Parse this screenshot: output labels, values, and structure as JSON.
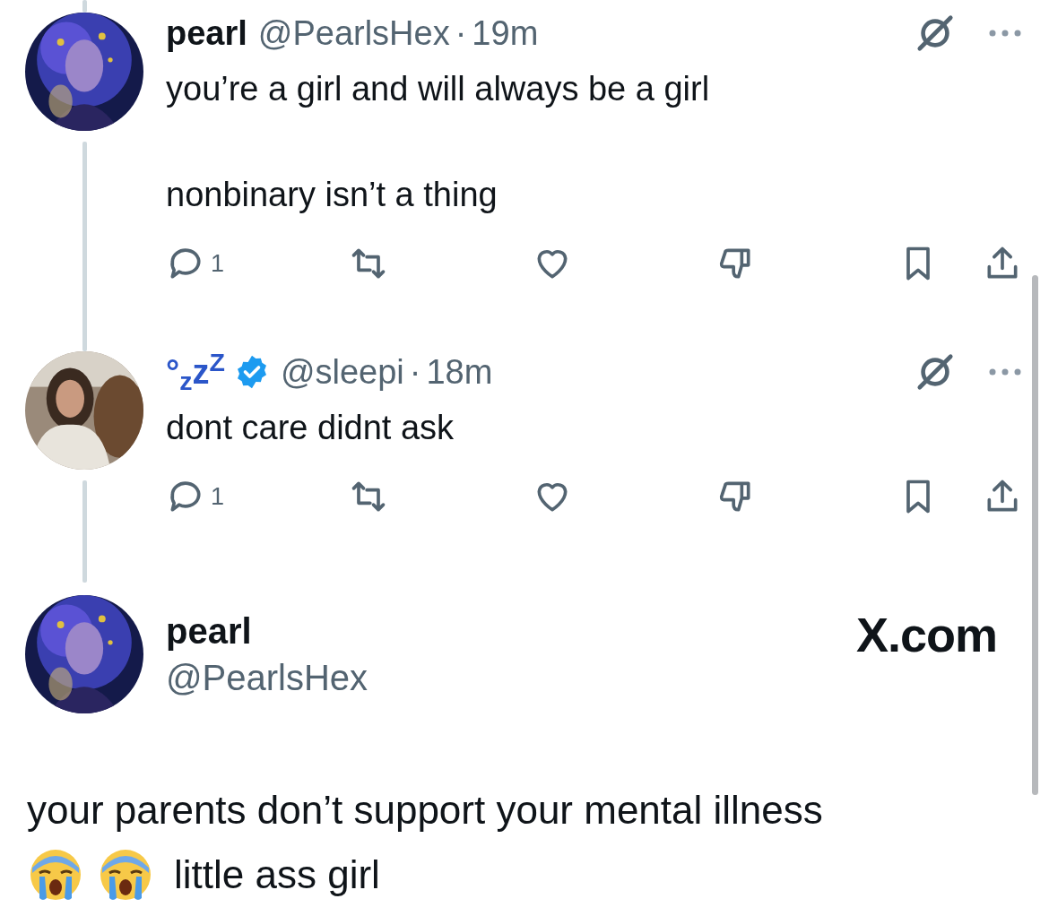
{
  "replies": [
    {
      "display_name": "pearl",
      "color": "#0f1419",
      "verified": false,
      "handle": "@PearlsHex",
      "separator": "·",
      "time": "19m",
      "text": [
        "you’re a girl and will always be a girl",
        "nonbinary isn’t a thing"
      ],
      "reply_count": "1"
    },
    {
      "display_name": "°$_{z}$z$^{Z}$",
      "color": "#2b56c9",
      "verified": true,
      "handle": "@sleepi",
      "separator": "·",
      "time": "18m",
      "text": [
        "dont care didnt ask"
      ],
      "reply_count": "1"
    }
  ],
  "main_post": {
    "display_name": "pearl",
    "handle": "@PearlsHex",
    "site_label": "X.com",
    "text": [
      "your parents don’t support your mental illness",
      "little ass girl"
    ]
  }
}
